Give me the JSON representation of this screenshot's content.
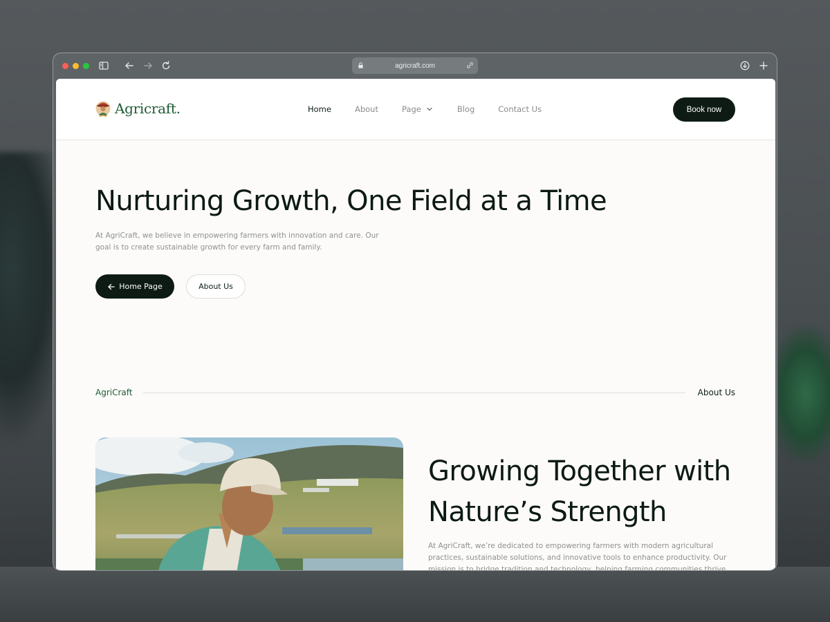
{
  "browser": {
    "url": "agricraft.com",
    "icons": [
      "sidebar-icon",
      "back-arrow-icon",
      "forward-arrow-icon",
      "reload-icon",
      "lock-icon",
      "link-icon",
      "download-icon",
      "new-tab-icon"
    ]
  },
  "nav": {
    "logo_text": "Agricraft.",
    "links": [
      {
        "label": "Home",
        "active": true
      },
      {
        "label": "About",
        "active": false
      },
      {
        "label": "Page",
        "active": false,
        "has_dropdown": true
      },
      {
        "label": "Blog",
        "active": false
      },
      {
        "label": "Contact Us",
        "active": false
      }
    ],
    "cta_label": "Book now"
  },
  "hero": {
    "title": "Nurturing Growth, One Field at a Time",
    "description": "At AgriCraft, we believe in empowering farmers with innovation and care. Our goal is to create sustainable growth for every farm and family.",
    "primary_button": "Home Page",
    "secondary_button": "About Us"
  },
  "section_header": {
    "label": "AgriCraft",
    "link": "About Us"
  },
  "about": {
    "title": "Growing Together with Nature’s Strength",
    "description": "At AgriCraft, we’re dedicated to empowering farmers with modern agricultural practices, sustainable solutions, and innovative tools to enhance productivity. Our mission is to bridge tradition and technology, helping farming communities thrive in a"
  },
  "colors": {
    "brand_green": "#1e5a36",
    "dark_button": "#0d1b14",
    "page_background": "#fcfbf9",
    "muted_text": "#8e918d"
  }
}
